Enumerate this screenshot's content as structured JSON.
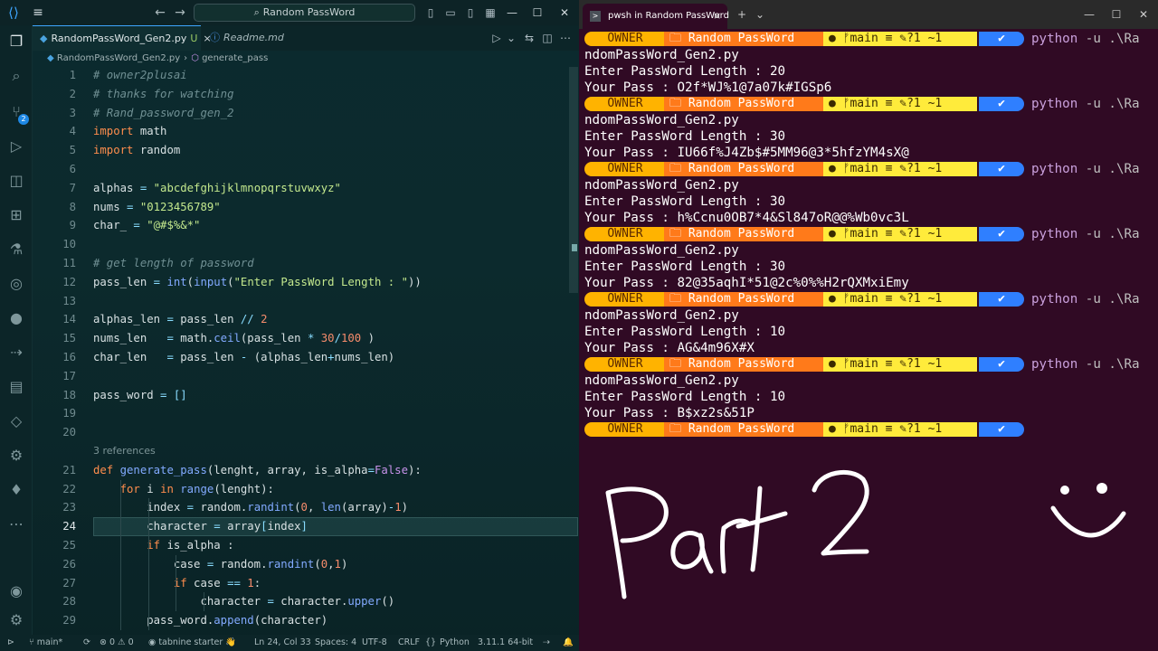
{
  "vscode": {
    "search_text": "Random PassWord",
    "tabs": [
      {
        "label": "RandomPassWord_Gen2.py",
        "badge": "U",
        "close": "×"
      },
      {
        "label": "Readme.md"
      }
    ],
    "breadcrumb": {
      "file": "RandomPassWord_Gen2.py",
      "sep": "›",
      "symbol": "generate_pass"
    },
    "refs_label": "3 references",
    "line_numbers": [
      "1",
      "2",
      "3",
      "4",
      "5",
      "6",
      "7",
      "8",
      "9",
      "10",
      "11",
      "12",
      "13",
      "14",
      "15",
      "16",
      "17",
      "18",
      "19",
      "20",
      "21",
      "22",
      "23",
      "24",
      "25",
      "26",
      "27",
      "28",
      "29"
    ],
    "code": [
      "# owner2plusai",
      "# thanks for watching",
      "# Rand_password_gen_2",
      "import math",
      "import random",
      "",
      "alphas = \"abcdefghijklmnopqrstuvwxyz\"",
      "nums = \"0123456789\"",
      "char_ = \"@#$%&*\"",
      "",
      "# get length of password",
      "pass_len = int(input(\"Enter PassWord Length : \"))",
      "",
      "alphas_len = pass_len // 2",
      "nums_len   = math.ceil(pass_len * 30/100 )",
      "char_len   = pass_len - (alphas_len+nums_len)",
      "",
      "pass_word = []",
      "",
      "",
      "def generate_pass(lenght, array, is_alpha=False):",
      "    for i in range(lenght):",
      "        index = random.randint(0, len(array)-1)",
      "        character = array[index]",
      "        if is_alpha :",
      "            case = random.randint(0,1)",
      "            if case == 1:",
      "                character = character.upper()",
      "        pass_word.append(character)"
    ],
    "status": {
      "branch": "main*",
      "problems": "0 ⚠ 0",
      "tabnine": "tabnine starter",
      "position": "Ln 24, Col 33",
      "spaces": "Spaces: 4",
      "encoding": "UTF-8",
      "eol": "CRLF",
      "language": "Python",
      "interpreter": "3.11.1 64-bit"
    }
  },
  "terminal": {
    "tab_title": "pwsh in Random PassWord",
    "tab_close": "×",
    "new_tab": "+",
    "dropdown": "⌄",
    "prompt": {
      "owner": "OWNER",
      "dir": "Random PassWord",
      "branch": "main",
      "git_status": "?1 ~1",
      "ok": "✔"
    },
    "command": {
      "exe": "python",
      "args": " -u .\\Ra",
      "wrap": "ndomPassWord_Gen2.py"
    },
    "runs": [
      {
        "length": "Enter PassWord Length : 20",
        "pass": "Your Pass : O2f*WJ%1@7a07k#IGSp6"
      },
      {
        "length": "Enter PassWord Length : 30",
        "pass": "Your Pass : IU66f%J4Zb$#5MM96@3*5hfzYM4sX@"
      },
      {
        "length": "Enter PassWord Length : 30",
        "pass": "Your Pass : h%Ccnu0OB7*4&Sl847oR@@%Wb0vc3L"
      },
      {
        "length": "Enter PassWord Length : 30",
        "pass": "Your Pass : 82@35aqhI*51@2c%0%%H2rQXMxiEmy"
      },
      {
        "length": "Enter PassWord Length : 10",
        "pass": "Your Pass : AG&4m96X#X"
      },
      {
        "length": "Enter PassWord Length : 10",
        "pass": "Your Pass : B$xz2s&51P"
      }
    ],
    "handwriting": "Part 2"
  }
}
